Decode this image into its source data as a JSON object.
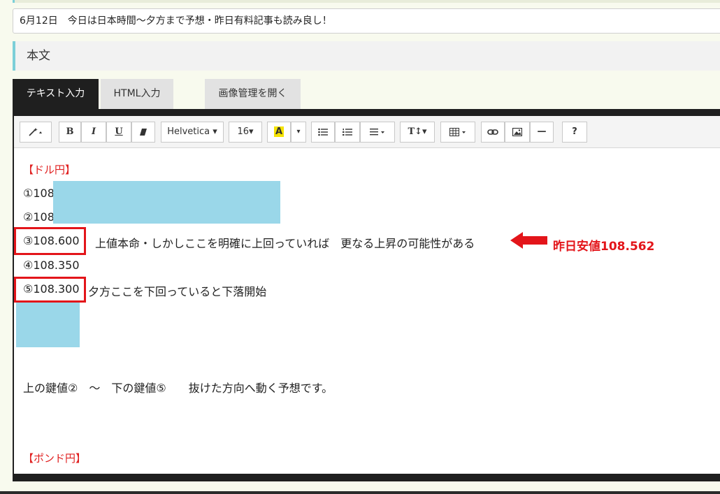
{
  "title_field": {
    "value": "6月12日　今日は日本時間～夕方まで予想・昨日有料記事も読み良し！"
  },
  "section": {
    "label": "本文"
  },
  "tabs": [
    {
      "label": "テキスト入力",
      "active": true
    },
    {
      "label": "HTML入力",
      "active": false
    },
    {
      "label": "画像管理を開く",
      "active": false
    }
  ],
  "toolbar": {
    "magic_icon": "magic-wand-icon",
    "bold": "B",
    "italic": "I",
    "underline": "U",
    "eraser_icon": "eraser-icon",
    "font_family": "Helvetica ▾",
    "font_size": "16▾",
    "color_letter": "A",
    "color_caret": "▾",
    "ul_icon": "unordered-list-icon",
    "ol_icon": "ordered-list-icon",
    "align_icon": "align-icon",
    "line_height": "T↕▾",
    "table_icon": "table-icon",
    "link_icon": "link-icon",
    "picture_icon": "picture-icon",
    "hr": "—",
    "help": "?"
  },
  "content": {
    "usd_label": "【ドル円】",
    "line1": "①108",
    "line2": "②108",
    "line3_num": "③108.600",
    "line3_text": "上値本命・しかしここを明確に上回っていれば　更なる上昇の可能性がある",
    "line4": "④108.350",
    "line5_num": "⑤108.300",
    "line5_text": "夕方ここを下回っていると下落開始",
    "summary": "上の鍵値②　～　下の鍵値⑤　　抜けた方向へ動く予想です。",
    "gbp_label": "【ポンド円】"
  },
  "annotation": {
    "text": "昨日安値108.562"
  },
  "colors": {
    "accent": "#7ccfd8",
    "annotation_red": "#e3151a",
    "highlight": "#9ad7e9"
  }
}
